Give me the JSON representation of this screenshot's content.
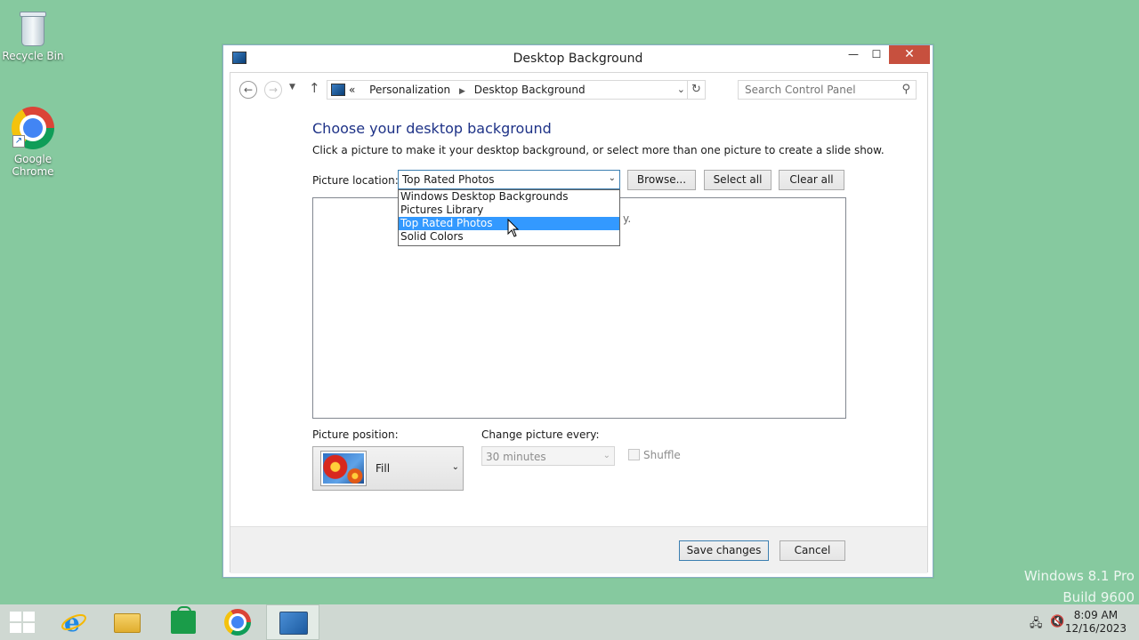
{
  "desktop": {
    "icons": [
      {
        "label": "Recycle Bin",
        "icon": "recycle-bin-icon"
      },
      {
        "label": "Google Chrome",
        "icon": "chrome-icon"
      }
    ],
    "watermark": {
      "line1": "Windows 8.1 Pro",
      "line2": "Build 9600"
    }
  },
  "window": {
    "title": "Desktop Background",
    "controls": {
      "minimize": "—",
      "maximize": "☐",
      "close": "✕"
    }
  },
  "navbar": {
    "breadcrumb_prefix": "«",
    "breadcrumb": [
      "Personalization",
      "Desktop Background"
    ],
    "search_placeholder": "Search Control Panel"
  },
  "content": {
    "heading": "Choose your desktop background",
    "description": "Click a picture to make it your desktop background, or select more than one picture to create a slide show.",
    "picture_location_label": "Picture location:",
    "picture_location_value": "Top Rated Photos",
    "picture_location_options": [
      {
        "label": "Windows Desktop Backgrounds",
        "selected": false
      },
      {
        "label": "Pictures Library",
        "selected": false
      },
      {
        "label": "Top Rated Photos",
        "selected": true
      },
      {
        "label": "Solid Colors",
        "selected": false
      }
    ],
    "browse_label": "Browse...",
    "select_all_label": "Select all",
    "clear_all_label": "Clear all",
    "obscured_text": "y.",
    "picture_position_label": "Picture position:",
    "picture_position_value": "Fill",
    "change_every_label": "Change picture every:",
    "change_every_value": "30 minutes",
    "shuffle_label": "Shuffle",
    "shuffle_checked": false
  },
  "footer": {
    "save_label": "Save changes",
    "cancel_label": "Cancel"
  },
  "taskbar": {
    "apps": [
      "start",
      "internet-explorer",
      "file-explorer",
      "store",
      "google-chrome",
      "control-panel"
    ],
    "clock_time": "8:09 AM",
    "clock_date": "12/16/2023"
  },
  "colors": {
    "desktop_bg": "#86c99f",
    "heading": "#1e3287",
    "selection": "#3399ff",
    "close_button": "#c7503e"
  }
}
